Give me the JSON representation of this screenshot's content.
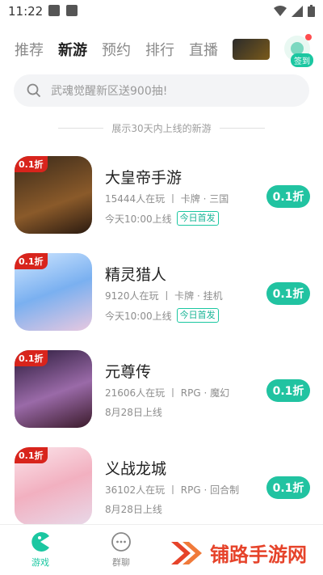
{
  "status_bar": {
    "time": "11:22"
  },
  "tabs": [
    {
      "label": "推荐",
      "active": false
    },
    {
      "label": "新游",
      "active": true
    },
    {
      "label": "预约",
      "active": false
    },
    {
      "label": "排行",
      "active": false
    },
    {
      "label": "直播",
      "active": false
    }
  ],
  "checkin": {
    "label": "签到"
  },
  "search": {
    "placeholder": "武魂觉醒新区送900抽!"
  },
  "hint": "展示30天内上线的新游",
  "games": [
    {
      "title": "大皇帝手游",
      "meta": "15444人在玩 丨 卡牌 · 三国",
      "release": "今天10:00上线",
      "badge": "今日首发",
      "discount": "0.1折",
      "tag": "0.1折"
    },
    {
      "title": "精灵猎人",
      "meta": "9120人在玩 丨 卡牌 · 挂机",
      "release": "今天10:00上线",
      "badge": "今日首发",
      "discount": "0.1折",
      "tag": "0.1折"
    },
    {
      "title": "元尊传",
      "meta": "21606人在玩 丨 RPG · 魔幻",
      "release": "8月28日上线",
      "badge": "",
      "discount": "0.1折",
      "tag": "0.1折"
    },
    {
      "title": "义战龙城",
      "meta": "36102人在玩 丨 RPG · 回合制",
      "release": "8月28日上线",
      "badge": "",
      "discount": "0.1折",
      "tag": "0.1折"
    }
  ],
  "bottom_nav": [
    {
      "label": "游戏",
      "active": true
    },
    {
      "label": "群聊",
      "active": false
    }
  ],
  "watermark": {
    "text": "铺路手游网"
  },
  "colors": {
    "accent": "#21c3a1",
    "discount_tag": "#d8241c",
    "watermark": "#e6432a"
  }
}
